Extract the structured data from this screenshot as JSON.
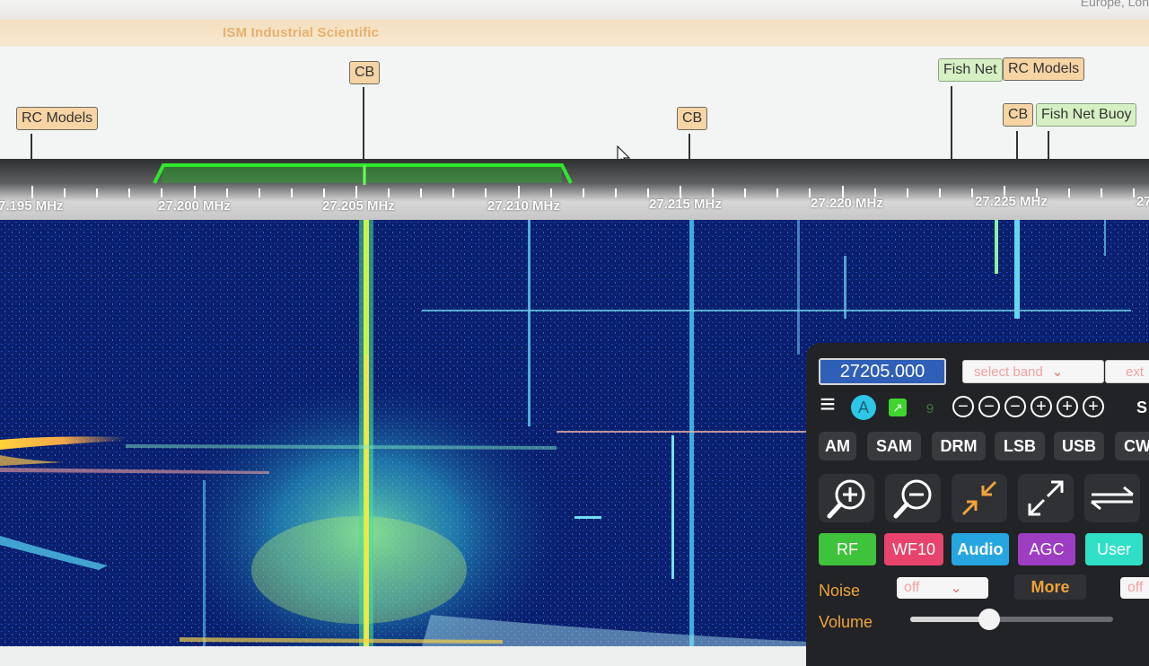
{
  "top": {
    "corner_text": "Europe, Lon"
  },
  "band_bar": {
    "name": "ISM Industrial Scientific"
  },
  "labels": [
    {
      "text": "RC Models",
      "style": "orange"
    },
    {
      "text": "CB",
      "style": "orange"
    },
    {
      "text": "CB",
      "style": "orange"
    },
    {
      "text": "Fish Net",
      "style": "green"
    },
    {
      "text": "RC Models",
      "style": "orange"
    },
    {
      "text": "CB",
      "style": "orange"
    },
    {
      "text": "Fish Net Buoy",
      "style": "green"
    }
  ],
  "scale": {
    "labels": [
      "7.195 MHz",
      "27.200 MHz",
      "27.205 MHz",
      "27.210 MHz",
      "27.215 MHz",
      "27.220 MHz",
      "27.225 MHz",
      "27"
    ],
    "passband_color": "#2ee82a"
  },
  "panel": {
    "frequency": "27205.000",
    "band_select": "select band",
    "ext_select": "ext",
    "hamburger_icon": "≡",
    "auto_label": "A",
    "nine_label": "9",
    "modes": [
      "AM",
      "SAM",
      "DRM",
      "LSB",
      "USB",
      "CW"
    ],
    "partial": "S",
    "controls": [
      {
        "label": "RF",
        "color": "#3fc23c"
      },
      {
        "label": "WF10",
        "color": "#e8436c"
      },
      {
        "label": "Audio",
        "color": "#25a6e0"
      },
      {
        "label": "AGC",
        "color": "#9d3ec2"
      },
      {
        "label": "User",
        "color": "#2fe0c6"
      }
    ],
    "noise_label": "Noise",
    "noise_value": "off",
    "more_label": "More",
    "off_right": "off",
    "volume_label": "Volume",
    "volume_level": 0.39
  },
  "colors": {
    "accent_orange": "#f1a33c",
    "waterfall_bg": "#0a1d66"
  }
}
